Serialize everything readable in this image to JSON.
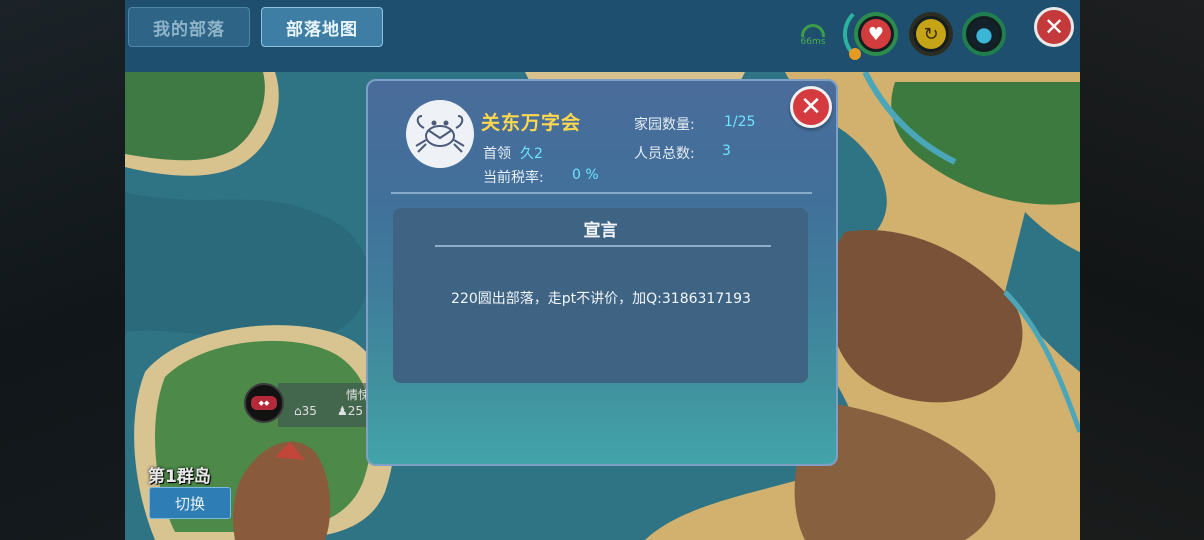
{
  "tabs": [
    {
      "label": "我的部落",
      "active": false
    },
    {
      "label": "部落地图",
      "active": true
    }
  ],
  "status": {
    "ping": "66ms",
    "icons": [
      "signal-icon",
      "heart-icon",
      "food-icon",
      "water-drop-icon",
      "close-icon"
    ]
  },
  "map": {
    "island_label": "第1群岛",
    "switch_label": "切换",
    "marker": {
      "name": "情悚",
      "homes": "35",
      "members": "25"
    }
  },
  "tribe": {
    "name": "关东万字会",
    "leader_label": "首领",
    "leader": "久2",
    "tax_label": "当前税率:",
    "tax_value": "0 %",
    "homes_label": "家园数量:",
    "homes_value": "1/25",
    "members_label": "人员总数:",
    "members_value": "3",
    "declaration_title": "宣言",
    "declaration": "220圆出部落，走pt不讲价，加Q:3186317193"
  },
  "colors": {
    "title_gold": "#ffd84d",
    "value_cyan": "#6fe3ff",
    "close_red": "#d43a3f"
  }
}
